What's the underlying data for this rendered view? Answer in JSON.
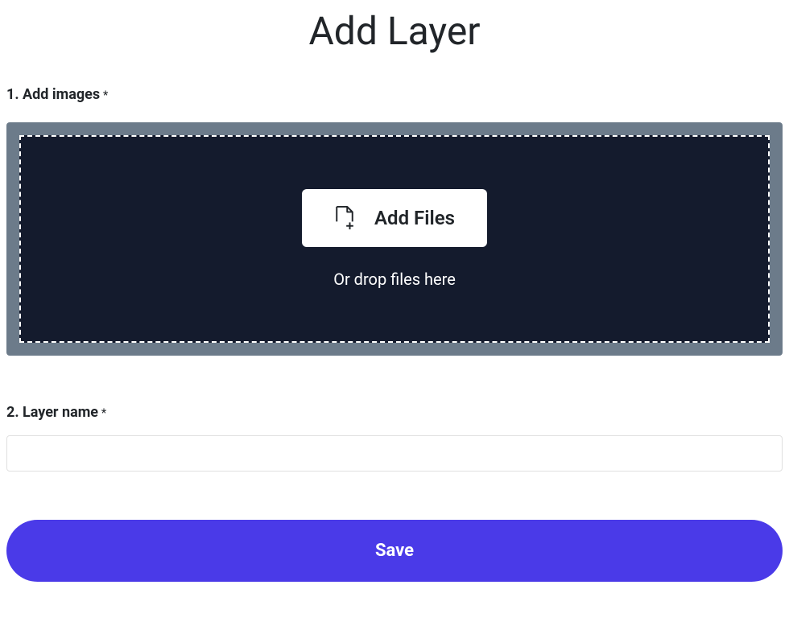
{
  "page": {
    "title": "Add Layer"
  },
  "section_images": {
    "label": "1. Add images",
    "required_mark": " *",
    "add_files_button_label": "Add Files",
    "drop_hint": "Or drop files here"
  },
  "section_name": {
    "label": "2. Layer name",
    "required_mark": " *",
    "input_value": "",
    "input_placeholder": ""
  },
  "actions": {
    "save_label": "Save"
  },
  "colors": {
    "accent": "#4a3ae8",
    "dropzone_bg": "#141b2d",
    "dropzone_border": "#6c7b8a"
  }
}
